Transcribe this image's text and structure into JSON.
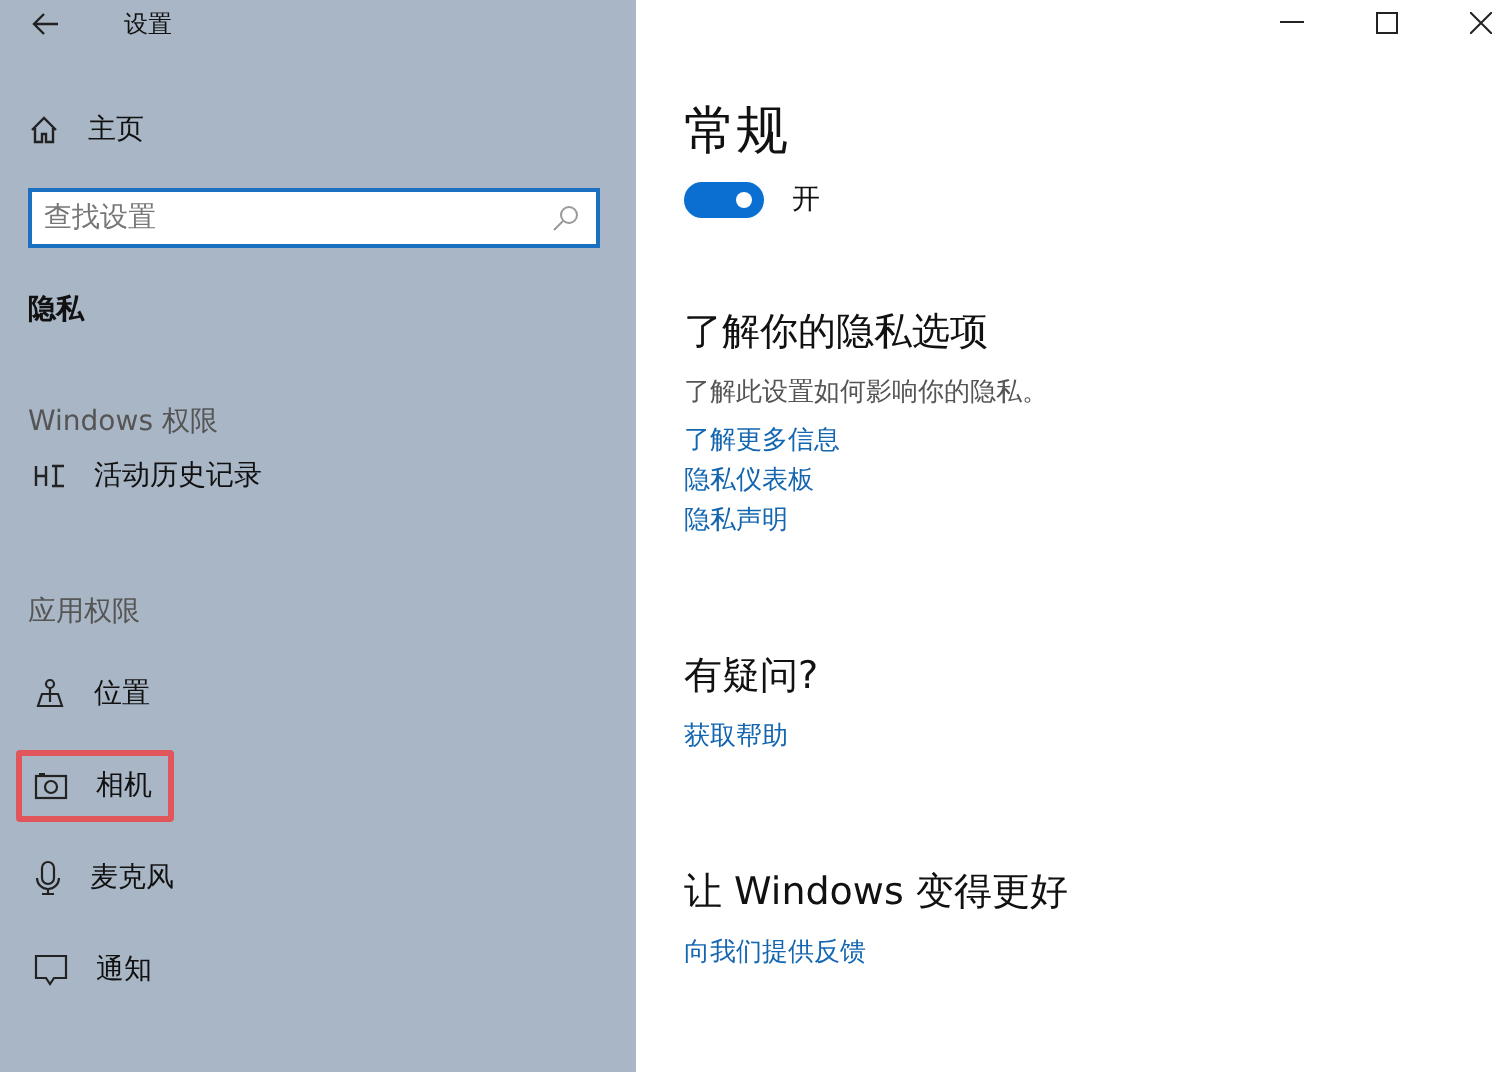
{
  "window": {
    "title": "设置"
  },
  "sidebar": {
    "home": "主页",
    "search": {
      "placeholder": "查找设置"
    },
    "section_title": "隐私",
    "groups": [
      {
        "title": "Windows 权限",
        "items": [
          {
            "label": "活动历史记录",
            "kind": "history",
            "highlighted": false
          }
        ]
      },
      {
        "title": "应用权限",
        "items": [
          {
            "label": "位置",
            "kind": "location",
            "highlighted": false
          },
          {
            "label": "相机",
            "kind": "camera",
            "highlighted": true
          },
          {
            "label": "麦克风",
            "kind": "microphone",
            "highlighted": false
          },
          {
            "label": "通知",
            "kind": "notification",
            "highlighted": false
          }
        ]
      }
    ]
  },
  "main": {
    "title": "常规",
    "toggle": {
      "on": true,
      "label": "开"
    },
    "sections": [
      {
        "heading": "了解你的隐私选项",
        "description": "了解此设置如何影响你的隐私。",
        "links": [
          "了解更多信息",
          "隐私仪表板",
          "隐私声明"
        ]
      },
      {
        "heading": "有疑问?",
        "links": [
          "获取帮助"
        ]
      },
      {
        "heading": "让 Windows 变得更好",
        "links": [
          "向我们提供反馈"
        ]
      }
    ]
  }
}
